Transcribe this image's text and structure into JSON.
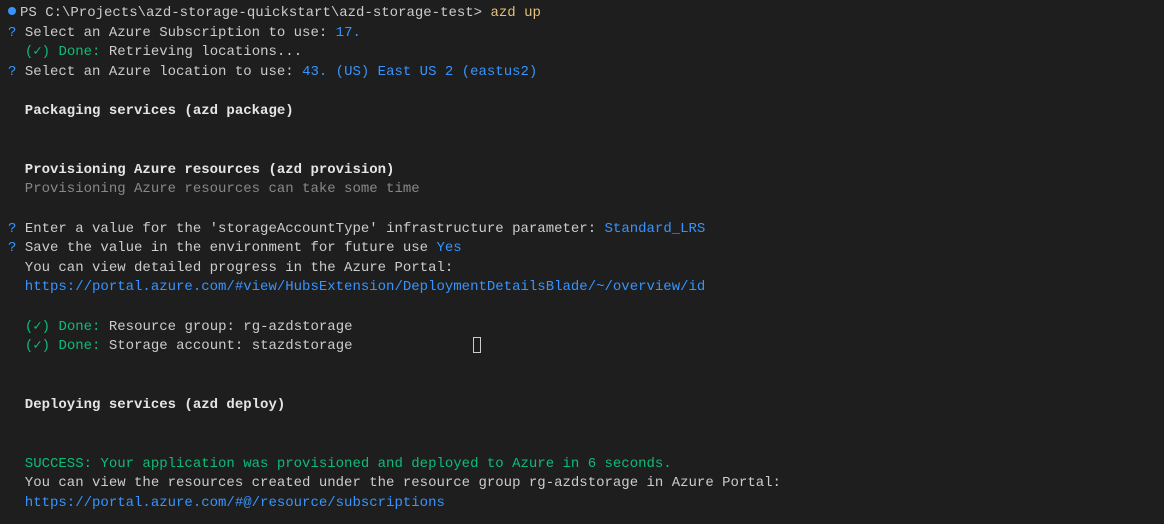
{
  "prompt": {
    "prefix": "PS C:\\Projects\\azd-storage-quickstart\\azd-storage-test>",
    "command": "azd up"
  },
  "subscription": {
    "q": "?",
    "label": "Select an Azure Subscription to use:",
    "value": "17."
  },
  "done1": {
    "check": "(✓)",
    "done": "Done:",
    "text": "Retrieving locations..."
  },
  "location": {
    "q": "?",
    "label": "Select an Azure location to use:",
    "value": "43. (US) East US 2 (eastus2)"
  },
  "packaging": {
    "heading": "  Packaging services (azd package)"
  },
  "provisioning": {
    "heading": "  Provisioning Azure resources (azd provision)",
    "subtext": "  Provisioning Azure resources can take some time"
  },
  "param": {
    "q": "?",
    "label": "Enter a value for the 'storageAccountType' infrastructure parameter:",
    "value": "Standard_LRS"
  },
  "save": {
    "q": "?",
    "label": "Save the value in the environment for future use",
    "value": "Yes"
  },
  "portal": {
    "intro": "  You can view detailed progress in the Azure Portal:",
    "url": "  https://portal.azure.com/#view/HubsExtension/DeploymentDetailsBlade/~/overview/id"
  },
  "done2": {
    "check": "(✓)",
    "done": "Done:",
    "text": "Resource group: rg-azdstorage"
  },
  "done3": {
    "check": "(✓)",
    "done": "Done:",
    "text": "Storage account: stazdstorage"
  },
  "deploying": {
    "heading": "  Deploying services (azd deploy)"
  },
  "success": {
    "line": "  SUCCESS: Your application was provisioned and deployed to Azure in 6 seconds."
  },
  "footer": {
    "text": "  You can view the resources created under the resource group rg-azdstorage in Azure Portal:",
    "url": "  https://portal.azure.com/#@/resource/subscriptions"
  }
}
